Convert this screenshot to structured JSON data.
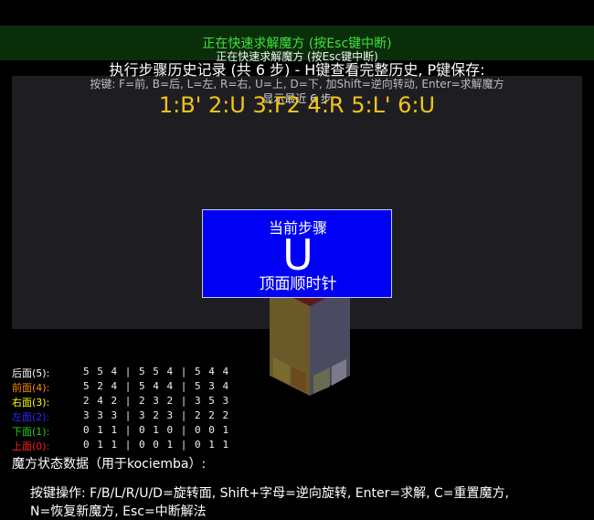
{
  "status": {
    "text": "正在快速求解魔方 (按Esc键中断)",
    "echo": "正在快速求解魔方 (按Esc键中断)"
  },
  "history": {
    "title": "执行步骤历史记录 (共 6 步) - H键查看完整历史, P键保存:",
    "key_help": "按键: F=前, B=后, L=左, R=右, U=上, D=下, 加Shift=逆向转动, Enter=求解魔方",
    "recent_label": "显示最近 6 步",
    "moves": "1:B' 2:U 3:F2 4:R 5:L' 6:U"
  },
  "current_step": {
    "title": "当前步骤",
    "move": "U",
    "description": "顶面顺时针"
  },
  "faces": [
    {
      "label": "后面(5):",
      "data": "5 5 4 | 5 5 4 | 5 4 4",
      "color": "#ffffff"
    },
    {
      "label": "前面(4):",
      "data": "5 2 4 | 5 4 4 | 5 3 4",
      "color": "#ff8c00"
    },
    {
      "label": "右面(3):",
      "data": "2 4 2 | 2 3 2 | 3 5 3",
      "color": "#ffff00"
    },
    {
      "label": "左面(2):",
      "data": "3 3 3 | 3 2 3 | 2 2 2",
      "color": "#2b2bff"
    },
    {
      "label": "下面(1):",
      "data": "0 1 1 | 0 1 0 | 0 0 1",
      "color": "#22d022"
    },
    {
      "label": "上面(0):",
      "data": "0 1 1 | 0 0 1 | 0 1 1",
      "color": "#ff2020"
    }
  ],
  "state_title": "魔方状态数据（用于kociemba）:",
  "help": {
    "line1": "按键操作: F/B/L/R/U/D=旋转面, Shift+字母=逆向旋转, Enter=求解, C=重置魔方,",
    "line2": "N=恢复新魔方, Esc=中断解法"
  }
}
